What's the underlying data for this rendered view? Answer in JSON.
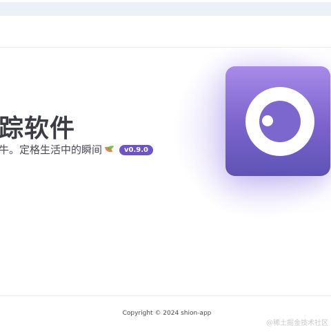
{
  "hero": {
    "title": "踪软件",
    "subtitle": "牛。定格生活中的瞬间",
    "subtitle_icon": "leaf-icon",
    "version": "v0.9.0"
  },
  "logo": {
    "icon": "camera-ring-icon",
    "colors": {
      "top": "#a88ae8",
      "bottom": "#5f52b5",
      "ring": "#ffffff"
    }
  },
  "footer": {
    "copyright": "Copyright © 2024 shion-app"
  },
  "watermark": "@稀土掘金技术社区",
  "colors": {
    "accent": "#6e52c7",
    "title_text": "#3c3c43",
    "body_text": "#4a4a55"
  }
}
